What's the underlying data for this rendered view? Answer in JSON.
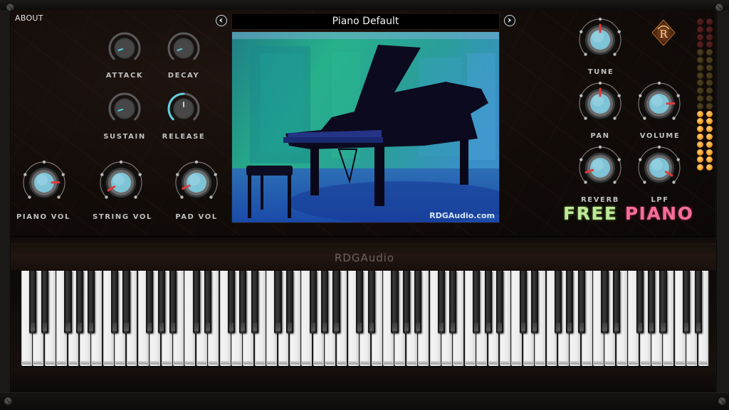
{
  "app": {
    "about_label": "ABOUT",
    "brand_word1": "FREE",
    "brand_word2": "PIANO",
    "brand_colors": {
      "free": "#bfe89a",
      "piano": "#f56d99"
    },
    "vendor_strip_label": "RDGAudio",
    "logo_letter": "R"
  },
  "preset": {
    "name": "Piano Default",
    "prev_icon": "chevron-left-icon",
    "next_icon": "chevron-right-icon",
    "image_caption": "RDGAudio.com"
  },
  "envelope_knobs": [
    {
      "id": "attack",
      "label": "ATTACK",
      "value": 0.1
    },
    {
      "id": "decay",
      "label": "DECAY",
      "value": 0.1
    },
    {
      "id": "sustain",
      "label": "SUSTAIN",
      "value": 0.1
    },
    {
      "id": "release",
      "label": "RELEASE",
      "value": 0.5
    }
  ],
  "mix_knobs": [
    {
      "id": "piano-vol",
      "label": "PIANO VOL",
      "value": 0.83
    },
    {
      "id": "string-vol",
      "label": "STRING VOL",
      "value": 0.05
    },
    {
      "id": "pad-vol",
      "label": "PAD VOL",
      "value": 0.08
    }
  ],
  "master_knobs": [
    {
      "id": "tune",
      "label": "TUNE",
      "value": 0.5
    },
    {
      "id": "pan",
      "label": "PAN",
      "value": 0.5
    },
    {
      "id": "volume",
      "label": "VOLUME",
      "value": 0.83
    },
    {
      "id": "reverb",
      "label": "REVERB",
      "value": 0.1
    },
    {
      "id": "lpf",
      "label": "LPF",
      "value": 0.95
    }
  ],
  "level_meter": {
    "channels": 2,
    "segments": 20,
    "lit_segments": 8,
    "colors": {
      "lit": "#f39a1e",
      "mid_off": "#3a2e14",
      "top_off": "#3d1414"
    }
  },
  "keyboard": {
    "first_note": "C",
    "last_note": "E",
    "white_keys": 59
  },
  "accent_colors": {
    "envelope_arc": "#5fd0e0",
    "pointer": "#e23a3a",
    "knob_cap": "#7ec3d6"
  }
}
